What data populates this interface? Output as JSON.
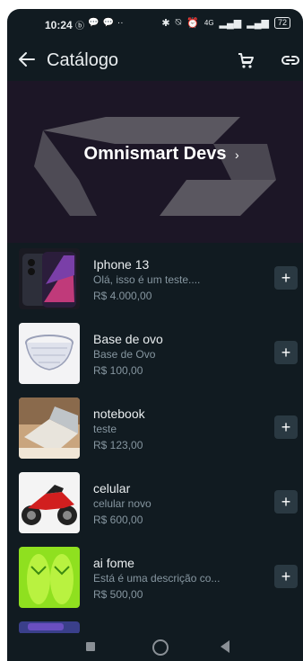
{
  "status_bar": {
    "time": "10:24",
    "left_icons": [
      "notification-b-icon",
      "chat-icon",
      "chat-icon",
      "more-dots-icon"
    ],
    "right_icons": [
      "bluetooth-icon",
      "mute-icon",
      "alarm-icon",
      "signal-icon",
      "signal-icon"
    ],
    "network": "4G",
    "battery": "72"
  },
  "app_bar": {
    "title": "Catálogo",
    "back_icon": "arrow-left-icon",
    "cart_icon": "cart-icon",
    "link_icon": "link-icon"
  },
  "banner": {
    "title": "Omnismart Devs"
  },
  "products": [
    {
      "name": "Iphone 13",
      "description": "Olá, isso é um teste....",
      "price": "R$ 4.000,00",
      "image": "iphone-image"
    },
    {
      "name": "Base de ovo",
      "description": "Base de Ovo",
      "price": "R$ 100,00",
      "image": "bowl-image"
    },
    {
      "name": "notebook",
      "description": "teste",
      "price": "R$ 123,00",
      "image": "notebook-image"
    },
    {
      "name": "celular",
      "description": "celular novo",
      "price": "R$ 600,00",
      "image": "motorcycle-image"
    },
    {
      "name": "ai fome",
      "description": "Está é uma descrição co...",
      "price": "R$ 500,00",
      "image": "flipflops-image"
    }
  ],
  "add_label": "+",
  "colors": {
    "background": "#111b21",
    "text_primary": "#e9edef",
    "text_secondary": "#8696a0",
    "button_bg": "#2a3942"
  }
}
